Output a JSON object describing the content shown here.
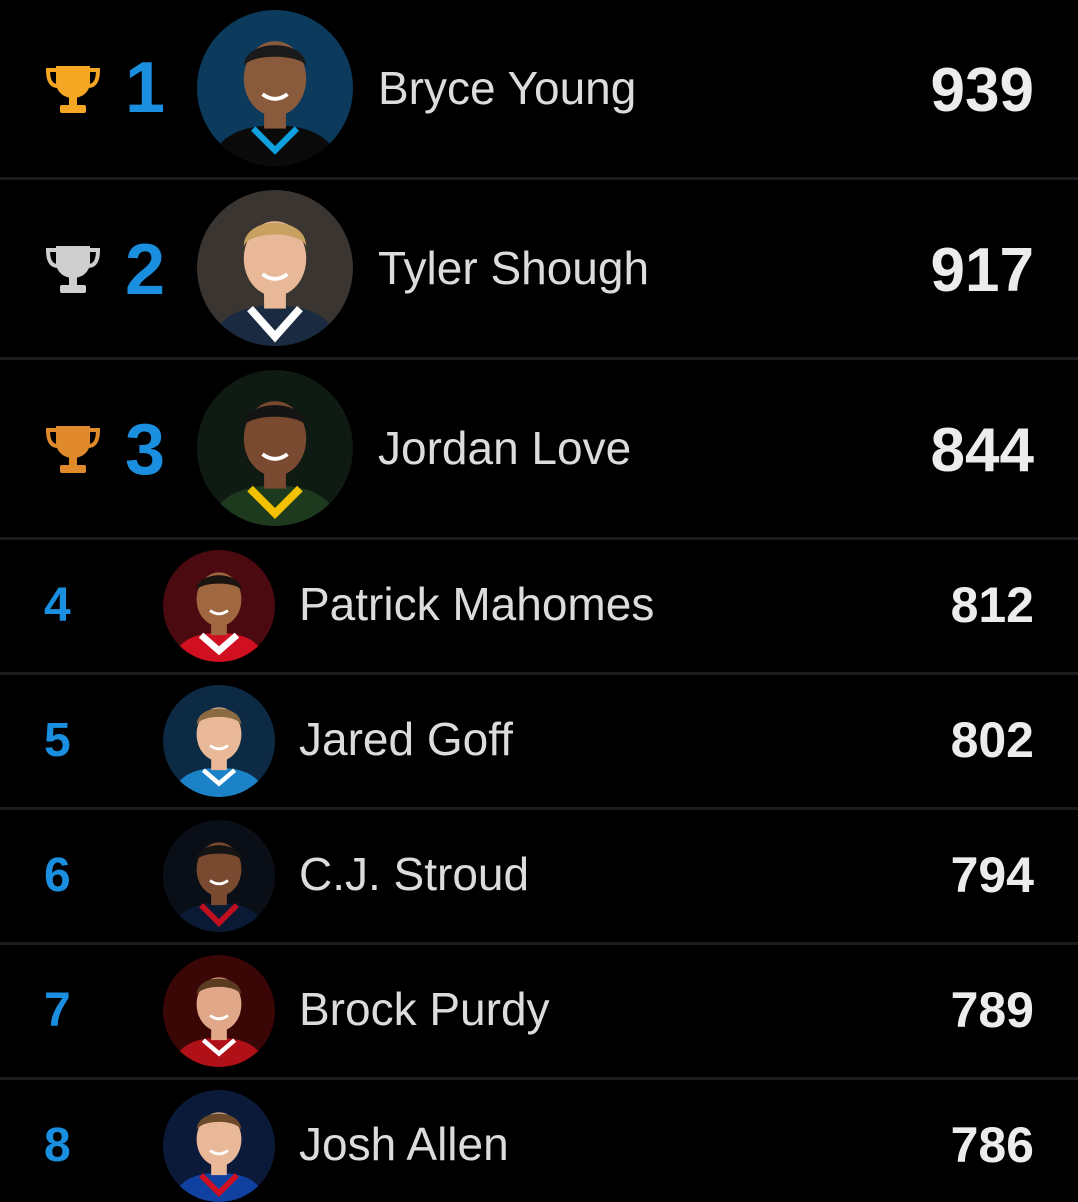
{
  "colors": {
    "background": "#000000",
    "rank": "#1a8fe0",
    "gold": "#f5a623",
    "silver": "#cfcfcf",
    "bronze": "#e08a2c",
    "divider": "#1c1c1e"
  },
  "leaderboard": [
    {
      "rank": "1",
      "name": "Bryce Young",
      "score": "939",
      "trophy": "gold-trophy-icon",
      "jersey": "#0a0a0a",
      "trim": "#0fa0e0",
      "avatar_bg": "#0b3a5c",
      "skin": "#8a5a3c",
      "hair": "#1a1a1a"
    },
    {
      "rank": "2",
      "name": "Tyler Shough",
      "score": "917",
      "trophy": "silver-trophy-icon",
      "jersey": "#1a2a40",
      "trim": "#ffffff",
      "avatar_bg": "#3a3530",
      "skin": "#e8b898",
      "hair": "#c8a060"
    },
    {
      "rank": "3",
      "name": "Jordan Love",
      "score": "844",
      "trophy": "bronze-trophy-icon",
      "jersey": "#1e3a1e",
      "trim": "#f2c200",
      "avatar_bg": "#0e1a12",
      "skin": "#7a4a30",
      "hair": "#141414"
    },
    {
      "rank": "4",
      "name": "Patrick Mahomes",
      "score": "812",
      "trophy": "",
      "jersey": "#d01020",
      "trim": "#ffffff",
      "avatar_bg": "#4a0a10",
      "skin": "#a06840",
      "hair": "#1a1410"
    },
    {
      "rank": "5",
      "name": "Jared Goff",
      "score": "802",
      "trophy": "",
      "jersey": "#1c82c8",
      "trim": "#ffffff",
      "avatar_bg": "#0c2a44",
      "skin": "#e8b898",
      "hair": "#8a6a40"
    },
    {
      "rank": "6",
      "name": "C.J. Stroud",
      "score": "794",
      "trophy": "",
      "jersey": "#0a1a34",
      "trim": "#c01020",
      "avatar_bg": "#0a0e16",
      "skin": "#7a4a30",
      "hair": "#141414"
    },
    {
      "rank": "7",
      "name": "Brock Purdy",
      "score": "789",
      "trophy": "",
      "jersey": "#b01018",
      "trim": "#ffffff",
      "avatar_bg": "#3a0606",
      "skin": "#e0a888",
      "hair": "#5a3a20"
    },
    {
      "rank": "8",
      "name": "Josh Allen",
      "score": "786",
      "trophy": "",
      "jersey": "#1040a0",
      "trim": "#d01020",
      "avatar_bg": "#0c1a3a",
      "skin": "#e8b898",
      "hair": "#6a4a2a"
    }
  ]
}
